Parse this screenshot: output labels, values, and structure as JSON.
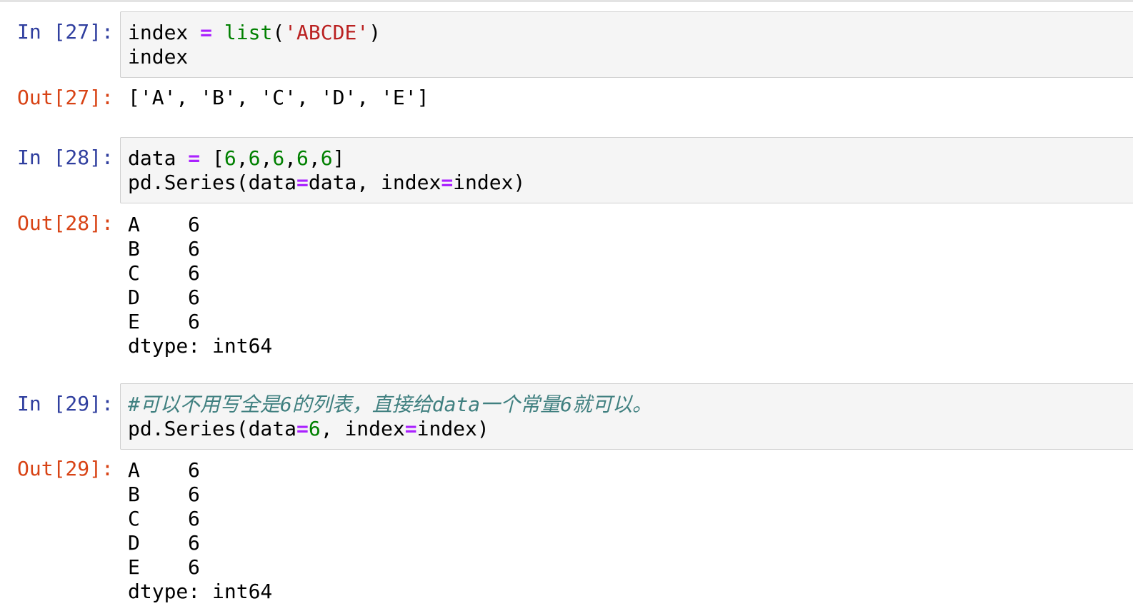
{
  "cells": [
    {
      "in_prompt": "In [27]:",
      "code": {
        "line1": {
          "var": "index",
          "sp1": " ",
          "op": "=",
          "sp2": " ",
          "func": "list",
          "lp": "(",
          "str": "'ABCDE'",
          "rp": ")"
        },
        "line2": "index"
      },
      "out_prompt": "Out[27]:",
      "output": "['A', 'B', 'C', 'D', 'E']"
    },
    {
      "in_prompt": "In [28]:",
      "code": {
        "line1": {
          "var": "data",
          "sp1": " ",
          "op": "=",
          "sp2": " ",
          "lb": "[",
          "n1": "6",
          "c1": ",",
          "n2": "6",
          "c2": ",",
          "n3": "6",
          "c3": ",",
          "n4": "6",
          "c4": ",",
          "n5": "6",
          "rb": "]"
        },
        "line2": {
          "a": "pd.Series(data",
          "op1": "=",
          "b": "data, index",
          "op2": "=",
          "c": "index)"
        }
      },
      "out_prompt": "Out[28]:",
      "output_rows": [
        {
          "label": "A",
          "value": "6"
        },
        {
          "label": "B",
          "value": "6"
        },
        {
          "label": "C",
          "value": "6"
        },
        {
          "label": "D",
          "value": "6"
        },
        {
          "label": "E",
          "value": "6"
        }
      ],
      "dtype": "dtype: int64"
    },
    {
      "in_prompt": "In [29]:",
      "code": {
        "comment": "#可以不用写全是6的列表，直接给data一个常量6就可以。",
        "line2": {
          "a": "pd.Series(data",
          "op1": "=",
          "num": "6",
          "b": ", index",
          "op2": "=",
          "c": "index)"
        }
      },
      "out_prompt": "Out[29]:",
      "output_rows": [
        {
          "label": "A",
          "value": "6"
        },
        {
          "label": "B",
          "value": "6"
        },
        {
          "label": "C",
          "value": "6"
        },
        {
          "label": "D",
          "value": "6"
        },
        {
          "label": "E",
          "value": "6"
        }
      ],
      "dtype": "dtype: int64"
    }
  ],
  "colors": {
    "in_prompt": "#303F9F",
    "out_prompt": "#D84315",
    "operator": "#AA22FF",
    "string": "#BA2121",
    "number": "#008000",
    "builtin": "#008000",
    "comment": "#408080",
    "cell_background": "#f5f5f5"
  }
}
